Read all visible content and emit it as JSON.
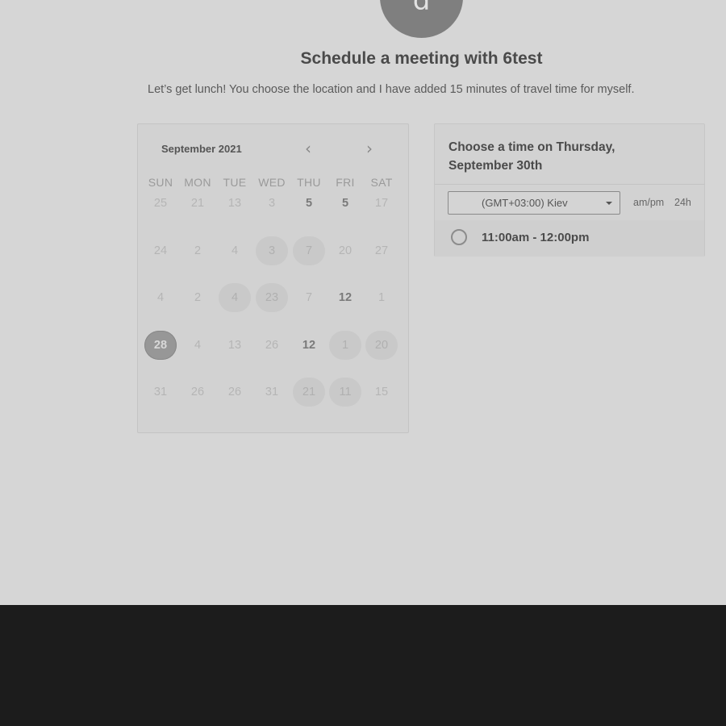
{
  "host": {
    "avatar_letter": "d"
  },
  "title": "Schedule a meeting with 6test",
  "subtitle": "Let’s get lunch! You choose the location and I have added 15 minutes of travel time for myself.",
  "calendar": {
    "month_label": "September 2021",
    "prev_icon": "chevron-left-icon",
    "next_icon": "chevron-right-icon",
    "weekdays": [
      "SUN",
      "MON",
      "TUE",
      "WED",
      "THU",
      "FRI",
      "SAT"
    ],
    "weeks": [
      [
        {
          "d": "25",
          "s": "muted"
        },
        {
          "d": "21",
          "s": "muted"
        },
        {
          "d": "13",
          "s": "muted"
        },
        {
          "d": "3",
          "s": "muted"
        },
        {
          "d": "5",
          "s": "bold"
        },
        {
          "d": "5",
          "s": "bold"
        },
        {
          "d": "17",
          "s": "muted"
        }
      ],
      [
        {
          "d": "24",
          "s": "muted"
        },
        {
          "d": "2",
          "s": "muted"
        },
        {
          "d": "4",
          "s": "muted"
        },
        {
          "d": "3",
          "s": "avail"
        },
        {
          "d": "7",
          "s": "avail"
        },
        {
          "d": "20",
          "s": "muted"
        },
        {
          "d": "27",
          "s": "muted"
        }
      ],
      [
        {
          "d": "4",
          "s": "muted"
        },
        {
          "d": "2",
          "s": "muted"
        },
        {
          "d": "4",
          "s": "avail"
        },
        {
          "d": "23",
          "s": "avail"
        },
        {
          "d": "7",
          "s": "muted"
        },
        {
          "d": "12",
          "s": "bold"
        },
        {
          "d": "1",
          "s": "muted"
        }
      ],
      [
        {
          "d": "28",
          "s": "selected"
        },
        {
          "d": "4",
          "s": "muted"
        },
        {
          "d": "13",
          "s": "muted"
        },
        {
          "d": "26",
          "s": "muted"
        },
        {
          "d": "12",
          "s": "bold"
        },
        {
          "d": "1",
          "s": "avail"
        },
        {
          "d": "20",
          "s": "avail"
        }
      ],
      [
        {
          "d": "31",
          "s": "muted"
        },
        {
          "d": "26",
          "s": "muted"
        },
        {
          "d": "26",
          "s": "muted"
        },
        {
          "d": "31",
          "s": "muted"
        },
        {
          "d": "21",
          "s": "avail"
        },
        {
          "d": "11",
          "s": "avail"
        },
        {
          "d": "15",
          "s": "muted"
        }
      ]
    ]
  },
  "time_panel": {
    "heading": "Choose a time on Thursday, September 30th",
    "timezone": "(GMT+03:00) Kiev",
    "format_ampm": "am/pm",
    "format_24h": "24h",
    "slots": [
      "11:00am - 12:00pm"
    ]
  },
  "colors": {
    "background": "#d6d6d6",
    "footer": "#1c1c1c",
    "avatar": "#7f7f7f"
  }
}
